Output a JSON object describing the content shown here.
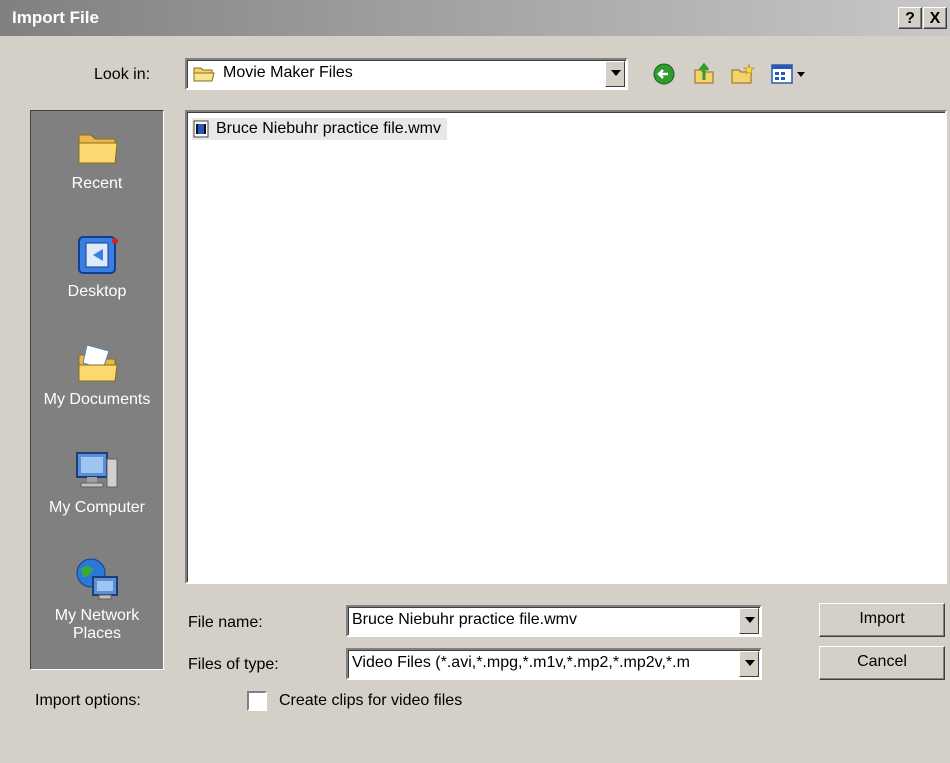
{
  "window": {
    "title": "Import File",
    "help_label": "?",
    "close_label": "X"
  },
  "look_in": {
    "label": "Look in:",
    "value": "Movie Maker Files"
  },
  "toolbar": {
    "icons": [
      "back-icon",
      "up-folder-icon",
      "new-folder-icon",
      "view-menu-icon"
    ]
  },
  "places": [
    {
      "label": "Recent",
      "icon": "recent-folder-icon"
    },
    {
      "label": "Desktop",
      "icon": "desktop-icon"
    },
    {
      "label": "My Documents",
      "icon": "my-documents-icon"
    },
    {
      "label": "My Computer",
      "icon": "my-computer-icon"
    },
    {
      "label": "My Network Places",
      "icon": "network-places-icon"
    }
  ],
  "files": [
    {
      "name": "Bruce Niebuhr practice file.wmv",
      "icon": "video-file-icon"
    }
  ],
  "file_name": {
    "label": "File name:",
    "value": "Bruce Niebuhr practice file.wmv"
  },
  "file_type": {
    "label": "Files of type:",
    "value": "Video Files (*.avi,*.mpg,*.m1v,*.mp2,*.mp2v,*.m"
  },
  "buttons": {
    "import": "Import",
    "cancel": "Cancel"
  },
  "import_options": {
    "label": "Import options:",
    "checkbox_label": "Create clips for video files",
    "checked": false
  }
}
